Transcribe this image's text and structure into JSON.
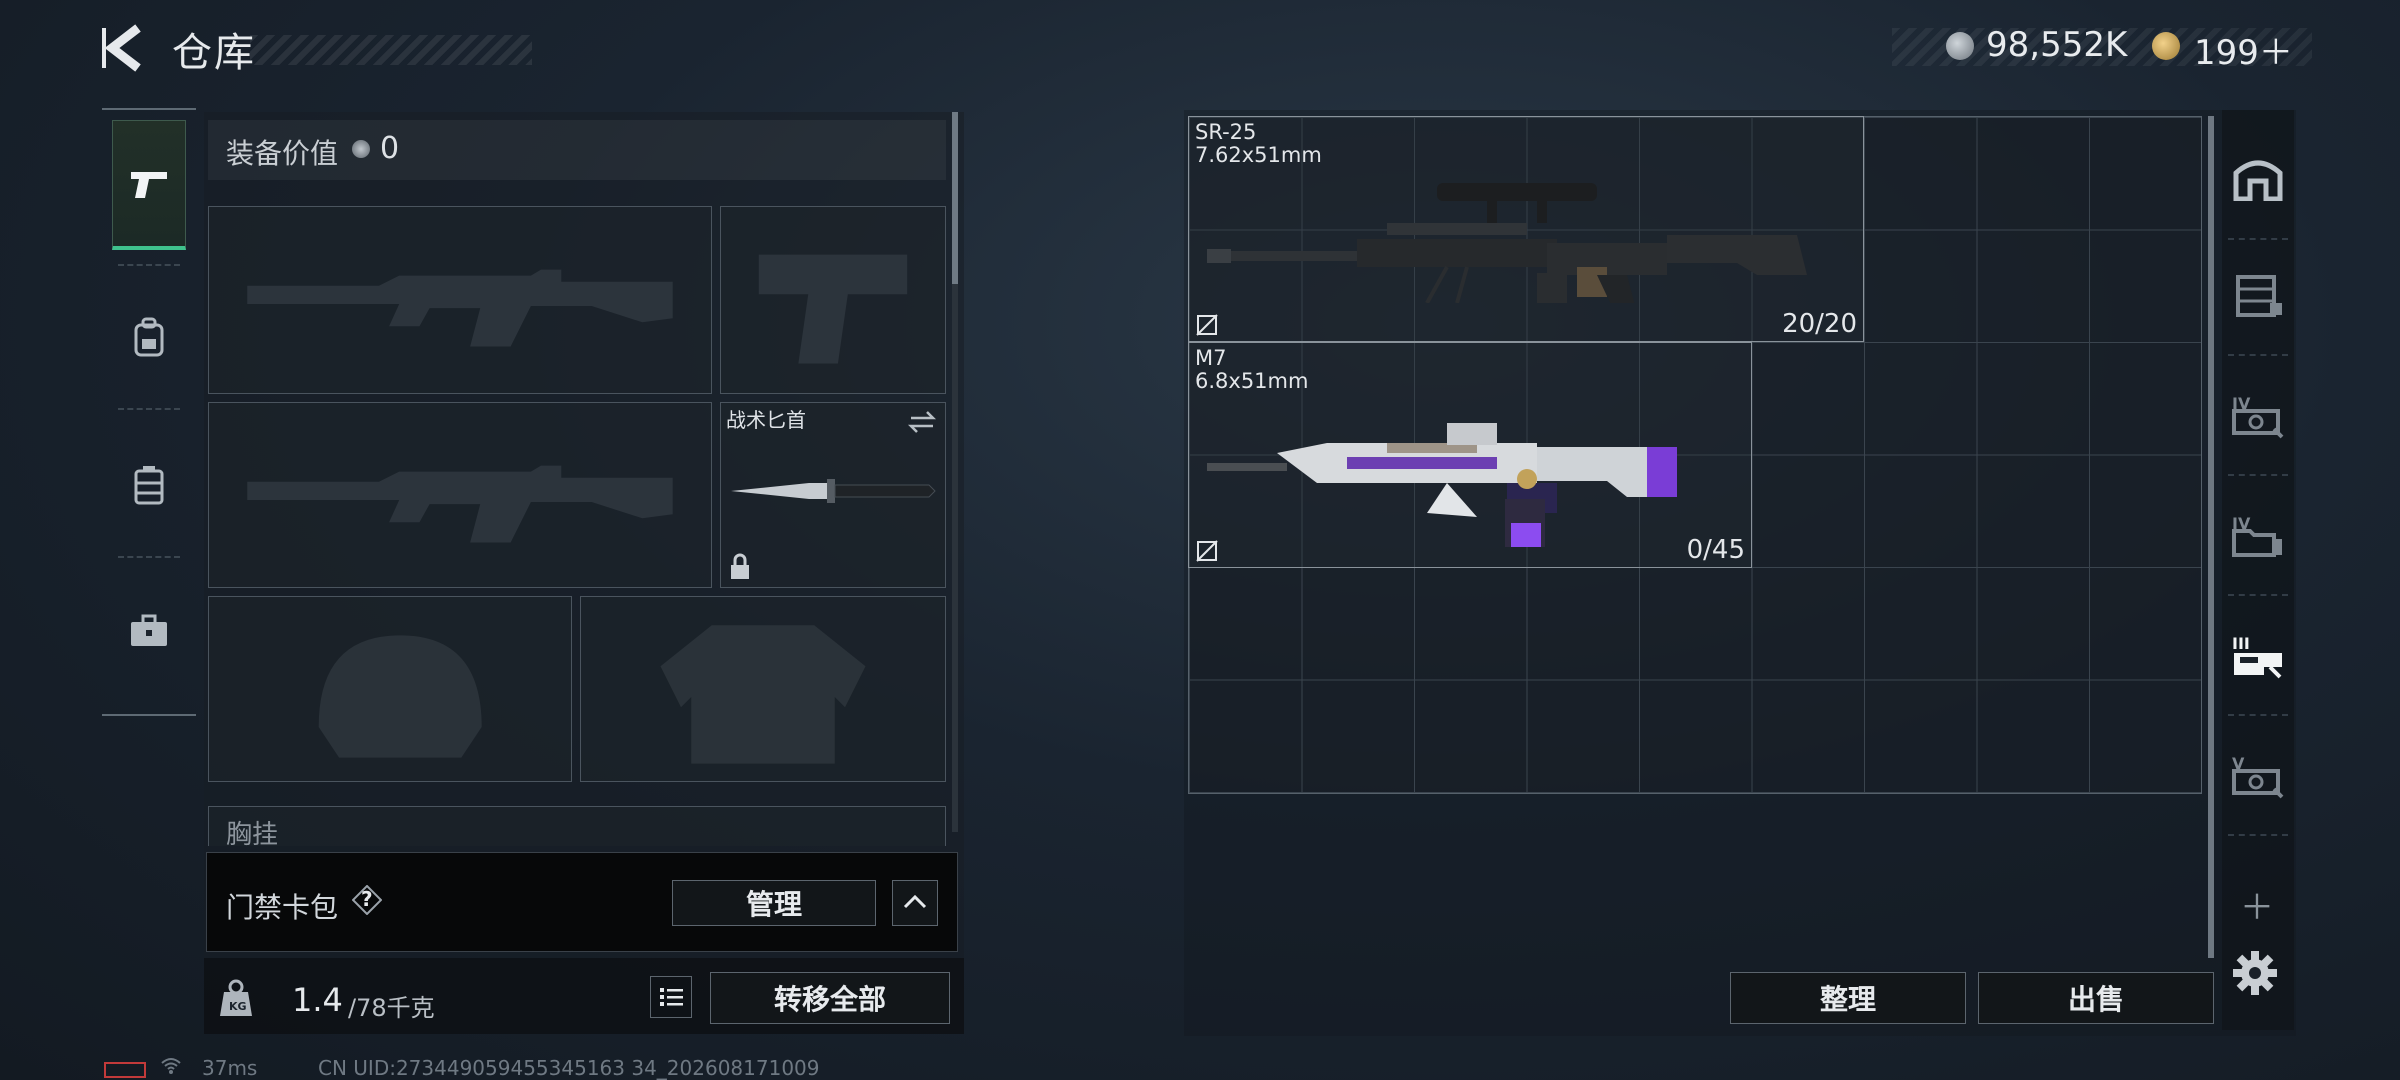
{
  "header": {
    "title": "仓库",
    "back_icon": "back-arrow-icon",
    "currencies": [
      {
        "icon": "silver-coin-icon",
        "value": "98,552K"
      },
      {
        "icon": "gold-coin-icon",
        "value": "199＋"
      }
    ]
  },
  "categories": [
    {
      "icon": "pistol-icon",
      "selected": true
    },
    {
      "icon": "backpack-icon",
      "selected": false
    },
    {
      "icon": "vest-icon",
      "selected": false
    },
    {
      "icon": "toolbox-icon",
      "selected": false
    }
  ],
  "loadout": {
    "equip_value_label": "装备价值",
    "equip_value": "0",
    "knife_label": "战术匕首",
    "chest_rig_label": "胸挂",
    "keycard": {
      "label": "门禁卡包",
      "help": "?",
      "manage_label": "管理"
    },
    "weight": {
      "current": "1.4",
      "max": "/78千克",
      "kg_icon": "kg-weight-icon"
    },
    "transfer_all_label": "转移全部"
  },
  "storage": {
    "items": [
      {
        "name": "SR-25",
        "caliber": "7.62x51mm",
        "ammo": "20/20"
      },
      {
        "name": "M7",
        "caliber": "6.8x51mm",
        "ammo": "0/45"
      }
    ],
    "sort_label": "整理",
    "sell_label": "出售"
  },
  "storage_tabs": [
    {
      "icon": "storage-home-icon"
    },
    {
      "icon": "storage-shelf-icon"
    },
    {
      "icon": "storage-iv-icon"
    },
    {
      "icon": "storage-iv-folder-icon"
    },
    {
      "icon": "storage-iii-icon",
      "selected": true
    },
    {
      "icon": "storage-v-icon"
    }
  ],
  "status": {
    "ping": "37ms",
    "uid": "CN UID:273449059455345163 34_202608171009"
  },
  "colors": {
    "accent": "#3fc28d",
    "border": "#5c656e"
  }
}
